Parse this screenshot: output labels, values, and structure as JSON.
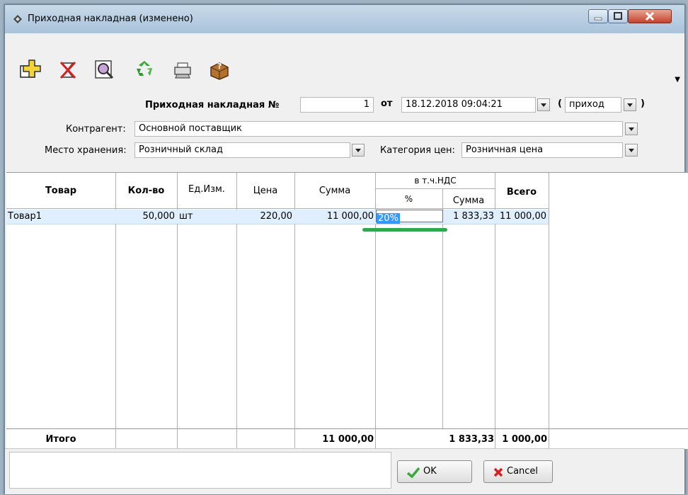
{
  "window": {
    "title": "Приходная накладная (изменено)"
  },
  "header": {
    "doc_label": "Приходная накладная №",
    "doc_number": "1",
    "from_label": "от",
    "date_value": "18.12.2018 09:04:21",
    "type_open": "(",
    "type_value": "приход",
    "type_close": ")",
    "counterparty_label": "Контрагент:",
    "counterparty_value": "Основной поставщик",
    "storage_label": "Место хранения:",
    "storage_value": "Розничный склад",
    "price_category_label": "Категория цен:",
    "price_category_value": "Розничная цена"
  },
  "table": {
    "columns": {
      "product": "Товар",
      "qty": "Кол-во",
      "unit": "Ед.Изм.",
      "price": "Цена",
      "sum": "Сумма",
      "vat_group": "в т.ч.НДС",
      "vat_pct": "%",
      "vat_sum": "Сумма",
      "total": "Всего"
    },
    "rows": [
      {
        "product": "Товар1",
        "qty": "50,000",
        "unit": "шт",
        "price": "220,00",
        "sum": "11 000,00",
        "vat_pct": "20%",
        "vat_sum": "1 833,33",
        "total": "11 000,00"
      }
    ],
    "footer": {
      "label": "Итого",
      "sum": "11 000,00",
      "vat_sum": "1 833,33",
      "total": "1 000,00"
    }
  },
  "buttons": {
    "ok": "OK",
    "cancel": "Cancel"
  },
  "colors": {
    "selection": "#3399ff",
    "highlight_line": "#2fa84f",
    "row_highlight": "#dfeffd"
  }
}
